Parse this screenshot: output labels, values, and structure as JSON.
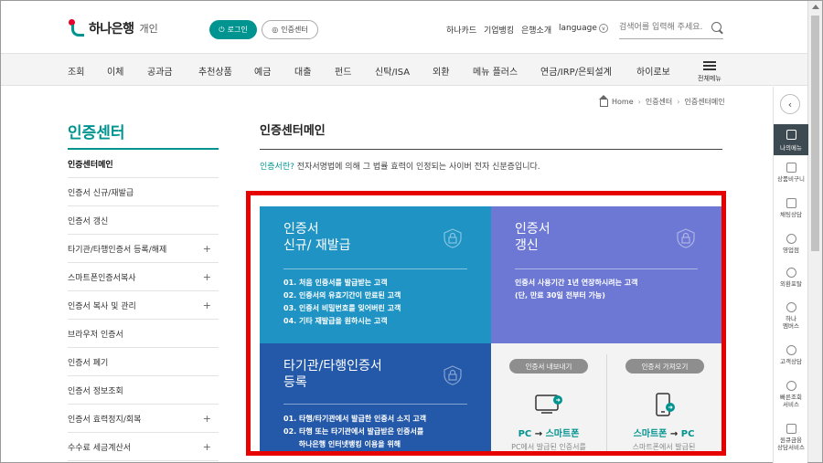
{
  "header": {
    "logo_text": "하나은행",
    "logo_sub": "개인",
    "login_label": "로그인",
    "cert_label": "인증센터",
    "links": [
      "하나카드",
      "기업뱅킹",
      "은행소개",
      "language"
    ],
    "search_placeholder": "검색어를 입력해 주세요."
  },
  "nav": {
    "items": [
      "조회",
      "이체",
      "공과금",
      "추천상품",
      "예금",
      "대출",
      "펀드",
      "신탁/ISA",
      "외환",
      "메뉴 플러스",
      "연금/IRP/은퇴설계",
      "하이로보"
    ],
    "all_menu_label": "전체메뉴"
  },
  "breadcrumb": [
    "Home",
    "인증센터",
    "인증센터메인"
  ],
  "sidebar": {
    "title": "인증센터",
    "items": [
      {
        "label": "인증센터메인",
        "expandable": false
      },
      {
        "label": "인증서 신규/재발급",
        "expandable": false
      },
      {
        "label": "인증서 갱신",
        "expandable": false
      },
      {
        "label": "타기관/타행인증서 등록/해제",
        "expandable": true
      },
      {
        "label": "스마트폰인증서복사",
        "expandable": true
      },
      {
        "label": "인증서 복사 및 관리",
        "expandable": true
      },
      {
        "label": "브라우저 인증서",
        "expandable": false
      },
      {
        "label": "인증서 폐기",
        "expandable": false
      },
      {
        "label": "인증서 정보조회",
        "expandable": false
      },
      {
        "label": "인증서 효력정지/회복",
        "expandable": true
      },
      {
        "label": "수수료 세금계산서",
        "expandable": true
      }
    ]
  },
  "main": {
    "title": "인증센터메인",
    "intro_highlight": "인증서란?",
    "intro_text": " 전자서명법에 의해 그 법률 효력이 인정되는 사이버 전자 신분증입니다.",
    "cards": {
      "issue": {
        "title": "인증서\n신규/ 재발급",
        "lines": [
          "01. 처음 인증서를 발급받는 고객",
          "02. 인증서의 유효기간이 만료된 고객",
          "03. 인증서 비밀번호를 잊어버린 고객",
          "04. 기타 재발급을 원하시는 고객"
        ],
        "color": "#1f94c4"
      },
      "renew": {
        "title": "인증서\n갱신",
        "lines": [
          "인증서 사용기간 1년 연장하시려는 고객",
          "(단, 만료 30일 전부터 가능)"
        ],
        "color": "#6c78d3"
      },
      "other": {
        "title": "타기관/타행인증서\n등록",
        "lines": [
          "01. 타행/타기관에서 발급한 인증서 소지 고객",
          "02. 타행 또는 타기관에서 발급받은 인증서를",
          "      하나은행 인터넷뱅킹 이용을 위해"
        ],
        "color": "#2458a8"
      }
    },
    "export": {
      "pill": "인증서 내보내기",
      "title_a": "PC",
      "arrow": " → ",
      "title_b": "스마트폰",
      "desc": "PC에서 발급된 인증서를"
    },
    "import": {
      "pill": "인증서 가져오기",
      "title_a": "스마트폰",
      "arrow": " → ",
      "title_b": "PC",
      "desc": "스마트폰에서 발급된"
    }
  },
  "rail": {
    "active_label": "나의메뉴",
    "items": [
      "상품비구니",
      "채팅상담",
      "영업점",
      "외환포탈",
      "하나\n멤버스",
      "고객상담",
      "빠른조회\n서비스",
      "원큐금융\n상담서비스"
    ]
  },
  "colors": {
    "brand": "#009490",
    "highlight_border": "#e60000"
  }
}
